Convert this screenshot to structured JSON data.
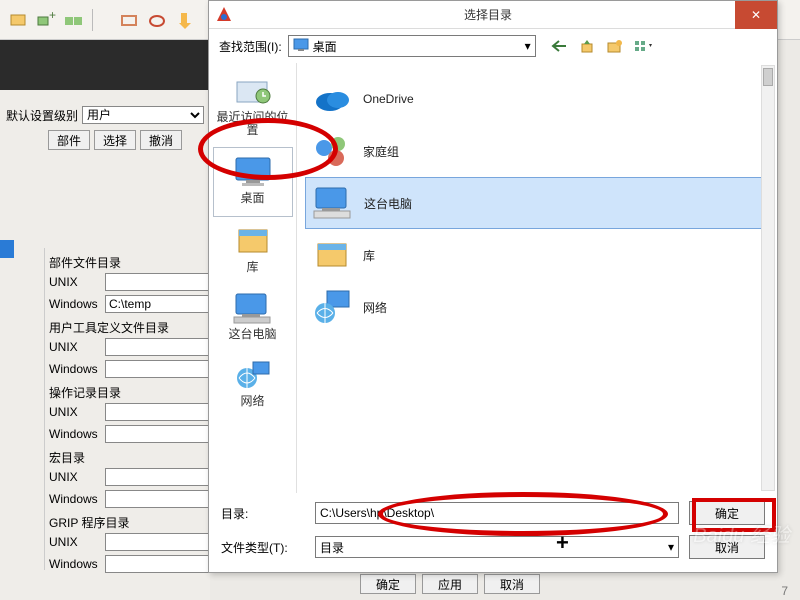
{
  "bg": {
    "level_label": "默认设置级别",
    "level_value": "用户",
    "tabs": {
      "parts": "部件",
      "select": "选择",
      "undo": "撤消"
    },
    "sections": {
      "part_dir": "部件文件目录",
      "user_tool_dir": "用户工具定义文件目录",
      "op_log_dir": "操作记录目录",
      "macro_dir": "宏目录",
      "grip_dir": "GRIP 程序目录"
    },
    "os": {
      "unix": "UNIX",
      "windows": "Windows"
    },
    "values": {
      "win_part": "C:\\temp"
    },
    "bottom": {
      "ok": "确定",
      "apply": "应用",
      "cancel": "取消"
    }
  },
  "dialog": {
    "title": "选择目录",
    "look_in_label": "查找范围(I):",
    "look_in_value": "桌面",
    "places": {
      "recent": "最近访问的位置",
      "desktop": "桌面",
      "libraries": "库",
      "computer": "这台电脑",
      "network": "网络"
    },
    "items": {
      "onedrive": "OneDrive",
      "homegroup": "家庭组",
      "computer": "这台电脑",
      "libraries": "库",
      "network": "网络"
    },
    "dir_label": "目录:",
    "dir_value": "C:\\Users\\hp\\Desktop\\",
    "type_label": "文件类型(T):",
    "type_value": "目录",
    "ok": "确定",
    "cancel": "取消"
  },
  "page_number": "7"
}
